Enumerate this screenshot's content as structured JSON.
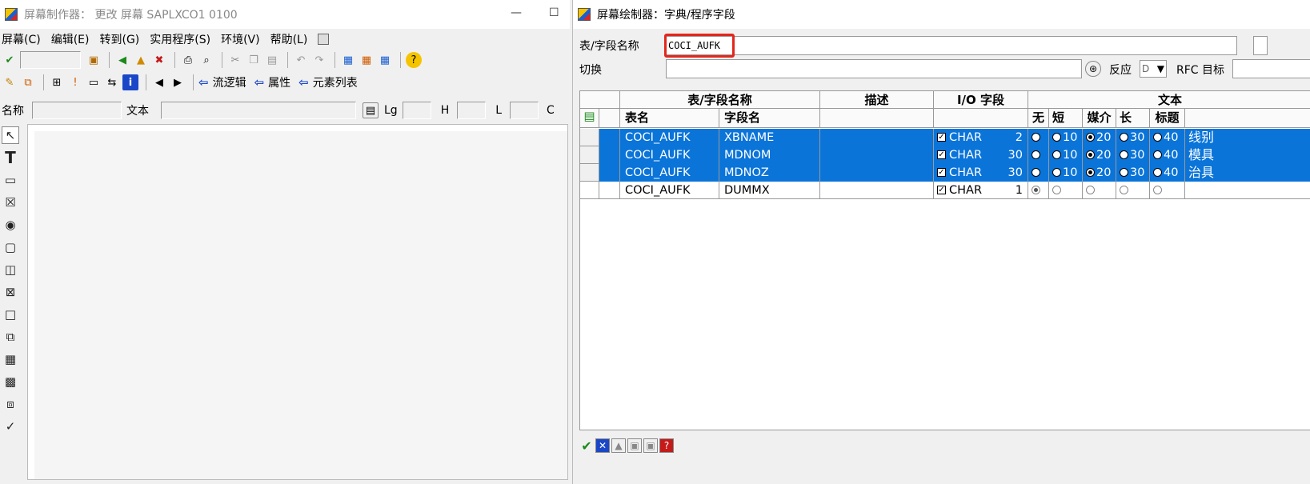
{
  "left_window": {
    "title": "屏幕制作器： 更改 屏幕 SAPLXCO1 0100",
    "menu": [
      "屏幕(C)",
      "编辑(E)",
      "转到(G)",
      "实用程序(S)",
      "环境(V)",
      "帮助(L)"
    ],
    "toolbar2_links": [
      "流逻辑",
      "属性",
      "元素列表"
    ],
    "fields": {
      "name_label": "名称",
      "text_label": "文本",
      "lg_label": "Lg",
      "h_label": "H",
      "l_label": "L",
      "c_label": "C"
    },
    "palette_icons": [
      "pointer-icon",
      "text-field-icon",
      "input-field-icon",
      "checkbox-icon",
      "radio-button-icon",
      "pushbutton-icon",
      "tabstrip-icon",
      "tabstrip-wizard-icon",
      "box-icon",
      "subscreen-icon",
      "table-control-icon",
      "table-wizard-icon",
      "custom-control-icon",
      "status-icon"
    ]
  },
  "right_window": {
    "title": "屏幕绘制器：字典/程序字段",
    "table_field_label": "表/字段名称",
    "table_field_value": "COCI_AUFK",
    "switch_label": "切换",
    "reaction_label": "反应",
    "reaction_value": "D",
    "rfc_label": "RFC 目标",
    "table": {
      "headers": {
        "group_name": "表/字段名称",
        "description": "描述",
        "io_field": "I/O 字段",
        "text": "文本",
        "table_name": "表名",
        "field_name": "字段名",
        "none": "无",
        "short": "短",
        "medium": "媒介",
        "long": "长",
        "heading": "标题"
      },
      "rows": [
        {
          "table": "COCI_AUFK",
          "field": "XBNAME",
          "type": "CHAR",
          "length": "2",
          "sizes": [
            "10",
            "20",
            "30",
            "40"
          ],
          "selected_size": 2,
          "text": "线别",
          "selected": true
        },
        {
          "table": "COCI_AUFK",
          "field": "MDNOM",
          "type": "CHAR",
          "length": "30",
          "sizes": [
            "10",
            "20",
            "30",
            "40"
          ],
          "selected_size": 2,
          "text": "模具",
          "selected": true
        },
        {
          "table": "COCI_AUFK",
          "field": "MDNOZ",
          "type": "CHAR",
          "length": "30",
          "sizes": [
            "10",
            "20",
            "30",
            "40"
          ],
          "selected_size": 2,
          "text": "治具",
          "selected": true
        },
        {
          "table": "COCI_AUFK",
          "field": "DUMMX",
          "type": "CHAR",
          "length": "1",
          "sizes": [
            "",
            "",
            "",
            ""
          ],
          "selected_size": 0,
          "text": "",
          "selected": false
        }
      ]
    },
    "accent_selected": "#0a74d9",
    "highlight_color": "#e3261c"
  }
}
